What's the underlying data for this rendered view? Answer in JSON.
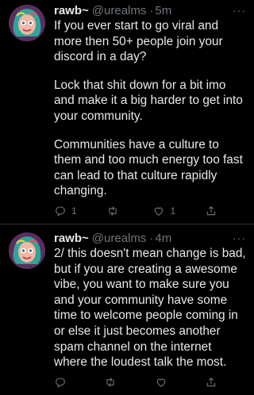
{
  "colors": {
    "background": "#000000",
    "text": "#e7e9ea",
    "secondary": "#71767b",
    "divider": "#2f3336"
  },
  "tweets": [
    {
      "name": "rawb~",
      "handle": "@urealms",
      "time": "5m",
      "more": "···",
      "paragraphs": [
        "If you ever start to go viral and more then 50+ people join your discord in a day?",
        "Lock that shit down for a bit imo and make it a big harder to get into your community.",
        "Communities have a culture to them and too much energy too fast can lead to that culture rapidly changing."
      ],
      "actions": {
        "reply_icon": "reply-icon",
        "reply_count": "1",
        "retweet_icon": "retweet-icon",
        "retweet_count": "",
        "like_icon": "like-icon",
        "like_count": "1",
        "share_icon": "share-icon"
      }
    },
    {
      "name": "rawb~",
      "handle": "@urealms",
      "time": "4m",
      "more": "···",
      "paragraphs": [
        "2/ this doesn't mean change is bad, but if you are creating a awesome vibe, you want to make sure you and your community have some time to welcome people coming in or else it just becomes another spam channel on the internet where the loudest talk the most."
      ],
      "actions": {
        "reply_icon": "reply-icon",
        "reply_count": "",
        "retweet_icon": "retweet-icon",
        "retweet_count": "",
        "like_icon": "like-icon",
        "like_count": "",
        "share_icon": "share-icon"
      }
    }
  ]
}
